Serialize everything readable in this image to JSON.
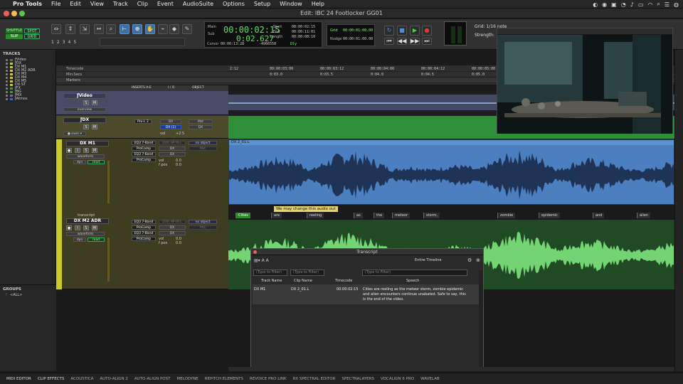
{
  "menubar": {
    "app": "Pro Tools",
    "items": [
      "File",
      "Edit",
      "View",
      "Track",
      "Clip",
      "Event",
      "AudioSuite",
      "Options",
      "Setup",
      "Window",
      "Help"
    ]
  },
  "window": {
    "title": "Edit: IBC 24 Footlocker GG01"
  },
  "toolbar": {
    "modes": {
      "shuffle": "SHUFFLE",
      "spot": "SPOT",
      "slip": "SLIP",
      "grid": "GRID"
    },
    "zoom_presets": [
      "1",
      "2",
      "3",
      "4",
      "5"
    ],
    "counter": {
      "main_label": "Main",
      "sub_label": "Sub",
      "main": "00:00:02:15",
      "sub": "0:02.627",
      "cursor_label": "Cursor",
      "cursor": "00:00:13:28",
      "sample": "-4966558",
      "dly": "Dly"
    },
    "selection": {
      "start_label": "Start",
      "end_label": "End",
      "length_label": "Length",
      "start": "00:00:02:15",
      "end": "00:00:11:01",
      "length": "00:00:08:10"
    },
    "grid": {
      "grid_label": "Grid",
      "nudge_label": "Nudge",
      "grid_value": "00:00:01:00.00",
      "nudge_value": "00:00:01:00.00",
      "grid_mode": "Grid: 1/16 note",
      "strength_label": "Strength:"
    }
  },
  "left": {
    "tracks_header": "TRACKS",
    "tracks": [
      {
        "name": "ƒVideo",
        "color": "#666"
      },
      {
        "name": "ƒDX",
        "color": "#c9c92a"
      },
      {
        "name": "DX M1",
        "color": "#c9c92a"
      },
      {
        "name": "DX M2 ADR",
        "color": "#c9c92a"
      },
      {
        "name": "DX M3",
        "color": "#c9c92a"
      },
      {
        "name": "DX M4",
        "color": "#c9c92a"
      },
      {
        "name": "DX M5",
        "color": "#c9c92a"
      },
      {
        "name": "DX ST",
        "color": "#c9c92a"
      },
      {
        "name": "ƒFX",
        "color": "#3c9a3c"
      },
      {
        "name": "ƒBG",
        "color": "#3c9a3c"
      },
      {
        "name": "ƒMX",
        "color": "#a04ac8"
      },
      {
        "name": "ƒAtmos",
        "color": "#3a6ac8"
      }
    ],
    "groups_header": "GROUPS",
    "groups": [
      {
        "id": "!",
        "name": "<ALL>"
      }
    ]
  },
  "rulers": {
    "rows": [
      "Timecode",
      "Min:Secs",
      "Markers"
    ],
    "timecode_ticks": [
      "2:12",
      "00:00:03:00",
      "00:00:03:12",
      "00:00:04:00",
      "00:00:04:12",
      "00:00:05:00"
    ],
    "minsec_ticks": [
      "0:03.0",
      "0:03.5",
      "0:04.0",
      "0:04.5",
      "0:05.0"
    ]
  },
  "columns": {
    "inserts": "INSERTS A-E",
    "io": "I / O",
    "object": "OBJECT"
  },
  "tracks": {
    "video": {
      "name": "ƒVideo",
      "s": "S",
      "m": "M",
      "mode": "overview"
    },
    "dx": {
      "name": "ƒDX",
      "s": "S",
      "m": "M",
      "view": "● ewer ▾",
      "insert": "Pro-L 2",
      "io1": "DX",
      "io2": "DX (1)",
      "io3": "Mst",
      "io4": "DX",
      "vol_label": "vol",
      "vol": "+2.5"
    },
    "m1": {
      "name": "DX M1",
      "s": "S",
      "m": "M",
      "view": "waveform",
      "dyn": "dyn",
      "read": "read",
      "ins1": "EQ3 7-Band",
      "ins2": "ProComp",
      "ins3": "EQ3 7-Band",
      "ins4": "ProComp",
      "io1": "DXR HP IN L",
      "io2": "DX",
      "io3": "DX",
      "obj": "no object",
      "obj2": "Mst",
      "vol_label": "vol",
      "vol": "0.0",
      "fpos_label": "f pos",
      "fpos": "0.0",
      "db": "0 dB"
    },
    "m2": {
      "name": "DX M2 ADR",
      "label_above": "transcript",
      "s": "S",
      "m": "M",
      "view": "waveform",
      "dyn": "dyn",
      "read": "read",
      "ins1": "EQ3 7-Band",
      "ins2": "ProComp",
      "ins3": "EQ3 7-Band",
      "ins4": "ProComp",
      "io1": "DXR HP IN L",
      "io2": "DX",
      "io3": "DX",
      "obj": "no object",
      "obj2": "Mst",
      "vol_label": "vol",
      "vol": "0.0",
      "fpos_label": "f pos",
      "fpos": "0.0"
    }
  },
  "clips": {
    "dx_clip": "DX 2_01.L",
    "marker": "We may change this audio out"
  },
  "words": [
    "Cities",
    "are",
    "reeling",
    "as",
    "the",
    "meteor",
    "storm,",
    "zombie",
    "epidemic",
    "and",
    "alien"
  ],
  "transcript": {
    "title": "Transcript",
    "scope": "Entire Timeline",
    "filters": [
      "(Type to Filter)",
      "(Type to Filter)",
      "(Type to Filter)"
    ],
    "headers": [
      "Track Name",
      "Clip Name",
      "Timecode",
      "Speech"
    ],
    "row": {
      "track": "DX M1",
      "clip": "DX 2_01.L",
      "timecode": "00:00:02:15",
      "speech": "Cities are reeling as the meteor storm, zombie epidemic and alien encounters continue unabated. Safe to say, this is the end of the video."
    }
  },
  "bottom": {
    "tabs": [
      "MIDI EDITOR",
      "CLIP EFFECTS",
      "ACOUSTICA",
      "AUTO-ALIGN 2",
      "AUTO-ALIGN POST",
      "MELODYNE",
      "REPITCH ELEMENTS",
      "REVOICE PRO LINK",
      "RX SPECTRAL EDITOR",
      "SPECTRALAYERS",
      "VOCALIGN 6 PRO",
      "WAVELAB"
    ]
  }
}
